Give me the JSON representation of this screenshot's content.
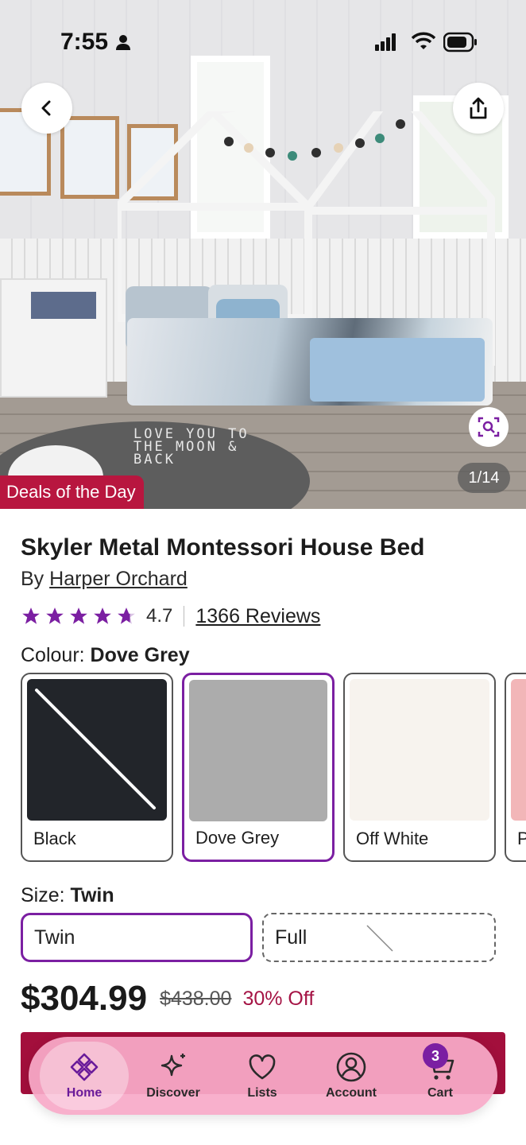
{
  "status_bar": {
    "time": "7:55"
  },
  "gallery": {
    "image_counter": "1/14",
    "deal_badge": "Deals of the Day",
    "rug_text": "LOVE YOU TO THE MOON & BACK"
  },
  "product": {
    "title": "Skyler Metal Montessori House Bed",
    "by_prefix": "By",
    "brand": "Harper Orchard",
    "rating": "4.7",
    "reviews": "1366 Reviews"
  },
  "colour": {
    "label": "Colour:",
    "selected": "Dove Grey",
    "options": [
      {
        "label": "Black",
        "color": "#22252a",
        "unavailable": true
      },
      {
        "label": "Dove Grey",
        "color": "#acacac",
        "unavailable": false
      },
      {
        "label": "Off White",
        "color": "#f7f3ee",
        "unavailable": false
      },
      {
        "label": "P",
        "color": "#f2b6b8",
        "unavailable": false
      }
    ]
  },
  "size": {
    "label": "Size:",
    "selected": "Twin",
    "options": [
      {
        "label": "Twin",
        "unavailable": false
      },
      {
        "label": "Full",
        "unavailable": true
      }
    ]
  },
  "pricing": {
    "price": "$304.99",
    "was": "$438.00",
    "discount": "30% Off"
  },
  "nav": {
    "items": [
      {
        "label": "Home",
        "icon": "home-icon"
      },
      {
        "label": "Discover",
        "icon": "sparkle-icon"
      },
      {
        "label": "Lists",
        "icon": "heart-icon"
      },
      {
        "label": "Account",
        "icon": "account-icon"
      },
      {
        "label": "Cart",
        "icon": "cart-icon"
      }
    ],
    "cart_count": "3"
  },
  "colors": {
    "accent": "#7b1fa2",
    "deal": "#b8163f",
    "discount": "#a51445",
    "nav_bg": "#f7aac8"
  }
}
